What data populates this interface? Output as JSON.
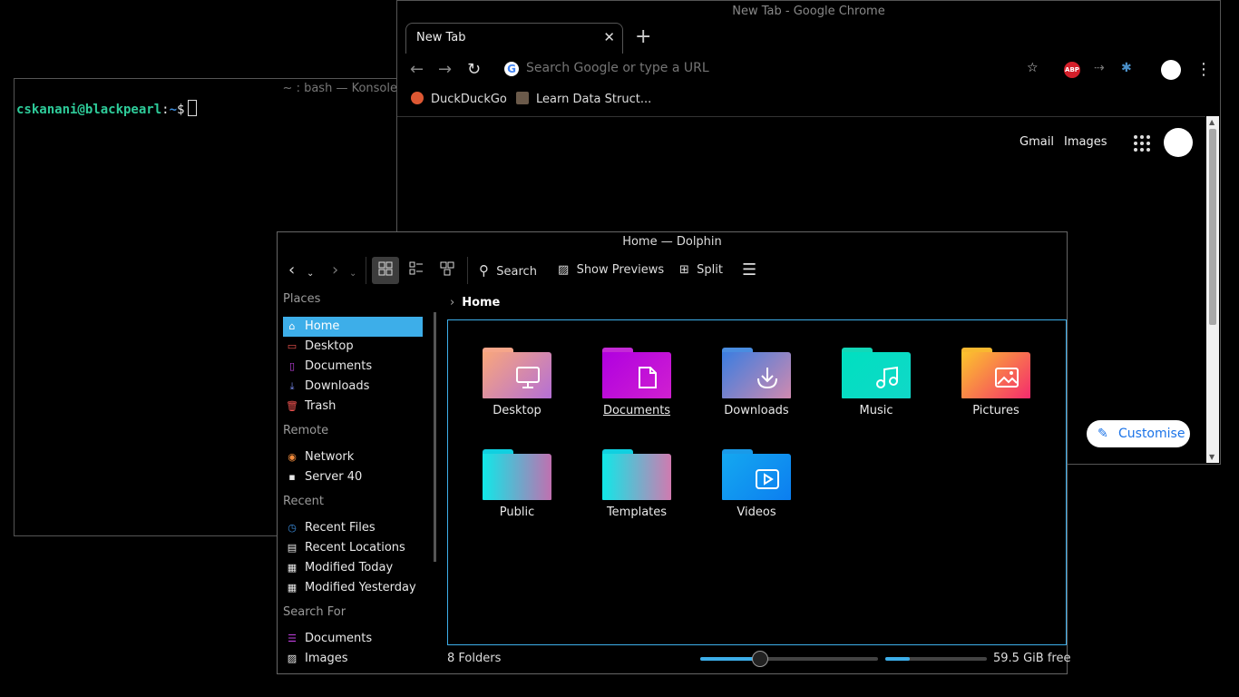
{
  "konsole": {
    "title": "~ : bash — Konsole",
    "prompt_user": "cskanani@blackpearl",
    "prompt_sep": ":",
    "prompt_dir": "~",
    "prompt_end": "$"
  },
  "chrome": {
    "window_title": "New Tab - Google Chrome",
    "tab_label": "New Tab",
    "omnibox_placeholder": "Search Google or type a URL",
    "abp_label": "ABP",
    "bookmarks": [
      "DuckDuckGo",
      "Learn Data Struct..."
    ],
    "links": {
      "gmail": "Gmail",
      "images": "Images"
    },
    "customise_label": "Customise"
  },
  "dolphin": {
    "window_title": "Home — Dolphin",
    "toolbar": {
      "search": "Search",
      "previews": "Show Previews",
      "split": "Split"
    },
    "places": {
      "places_header": "Places",
      "places": [
        "Home",
        "Desktop",
        "Documents",
        "Downloads",
        "Trash"
      ],
      "remote_header": "Remote",
      "remote": [
        "Network",
        "Server 40"
      ],
      "recent_header": "Recent",
      "recent": [
        "Recent Files",
        "Recent Locations",
        "Modified Today",
        "Modified Yesterday"
      ],
      "search_header": "Search For",
      "search": [
        "Documents",
        "Images"
      ]
    },
    "breadcrumb": "Home",
    "folders": [
      "Desktop",
      "Documents",
      "Downloads",
      "Music",
      "Pictures",
      "Public",
      "Templates",
      "Videos"
    ],
    "status": "8 Folders",
    "zoom_level": 0.33,
    "space_used": 0.24,
    "free_space": "59.5 GiB free"
  },
  "colors": {
    "accent": "#3daee9",
    "prompt_user": "#2ecc9a",
    "prompt_dir": "#3d8fe0"
  }
}
